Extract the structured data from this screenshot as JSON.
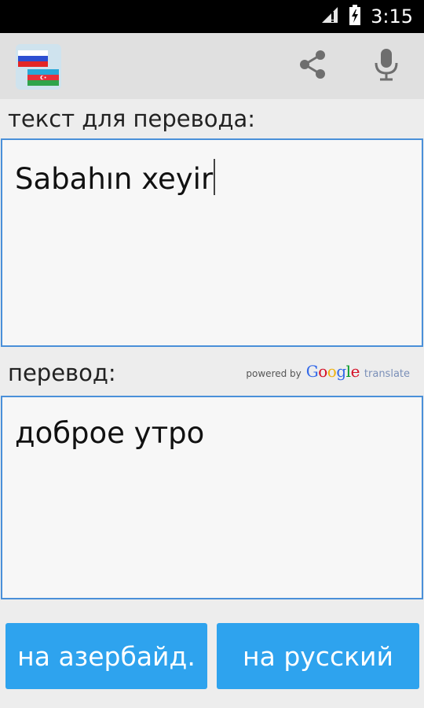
{
  "status_bar": {
    "time": "3:15"
  },
  "input": {
    "label": "текст для перевода:",
    "text": "Sabahın xeyir"
  },
  "output": {
    "label": "перевод:",
    "text": "доброе утро"
  },
  "attribution": {
    "powered_by": "powered by",
    "google_letters": [
      "G",
      "o",
      "o",
      "g",
      "l",
      "e"
    ],
    "google_colors": [
      "#3369e8",
      "#d50f25",
      "#eeb211",
      "#3369e8",
      "#009925",
      "#d50f25"
    ],
    "translate": "translate"
  },
  "buttons": {
    "to_azerbaijani": "на азербайд.",
    "to_russian": "на русский"
  },
  "colors": {
    "accent": "#2ea3ee",
    "input_border": "#4a90d9",
    "action_bar": "#e0e0e0"
  },
  "icons": [
    "signal-icon",
    "battery-icon",
    "app-flags-icon",
    "share-icon",
    "microphone-icon"
  ]
}
